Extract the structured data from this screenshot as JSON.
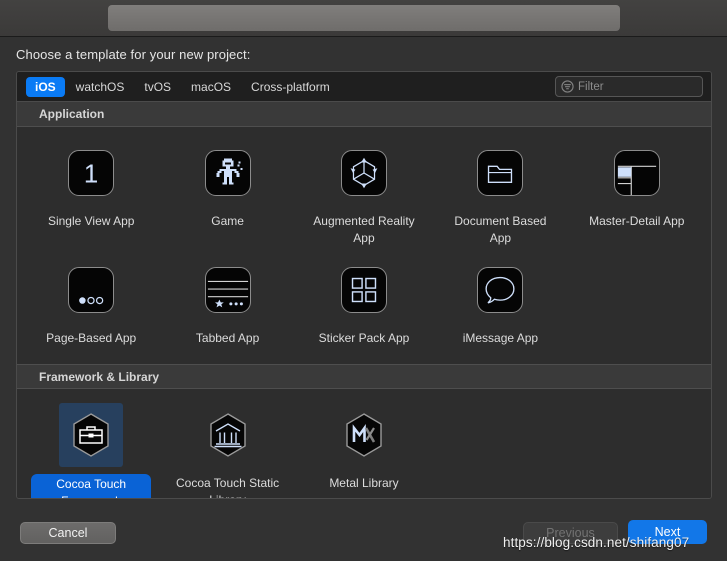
{
  "window": {
    "titlebar_redacted": true
  },
  "prompt": "Choose a template for your new project:",
  "platform_tabs": [
    {
      "label": "iOS",
      "selected": true
    },
    {
      "label": "watchOS",
      "selected": false
    },
    {
      "label": "tvOS",
      "selected": false
    },
    {
      "label": "macOS",
      "selected": false
    },
    {
      "label": "Cross-platform",
      "selected": false
    }
  ],
  "filter": {
    "placeholder": "Filter",
    "value": "",
    "icon": "filter-icon"
  },
  "sections": [
    {
      "title": "Application",
      "templates": [
        {
          "label": "Single View App",
          "icon": "single-view-app-icon",
          "selected": false
        },
        {
          "label": "Game",
          "icon": "game-icon",
          "selected": false
        },
        {
          "label": "Augmented Reality App",
          "icon": "augmented-reality-app-icon",
          "selected": false
        },
        {
          "label": "Document Based App",
          "icon": "document-based-app-icon",
          "selected": false
        },
        {
          "label": "Master-Detail App",
          "icon": "master-detail-app-icon",
          "selected": false
        },
        {
          "label": "Page-Based App",
          "icon": "page-based-app-icon",
          "selected": false
        },
        {
          "label": "Tabbed App",
          "icon": "tabbed-app-icon",
          "selected": false
        },
        {
          "label": "Sticker Pack App",
          "icon": "sticker-pack-app-icon",
          "selected": false
        },
        {
          "label": "iMessage App",
          "icon": "imessage-app-icon",
          "selected": false
        }
      ]
    },
    {
      "title": "Framework & Library",
      "templates": [
        {
          "label": "Cocoa Touch Framework",
          "icon": "cocoa-touch-framework-icon",
          "selected": true
        },
        {
          "label": "Cocoa Touch Static Library",
          "icon": "cocoa-touch-static-library-icon",
          "selected": false
        },
        {
          "label": "Metal Library",
          "icon": "metal-library-icon",
          "selected": false
        }
      ]
    }
  ],
  "buttons": {
    "cancel": "Cancel",
    "previous": "Previous",
    "next": "Next"
  },
  "watermark": "https://blog.csdn.net/shifang07",
  "colors": {
    "accent_blue": "#0a7bf5",
    "selected_label_blue": "#0a63d6",
    "selected_tile_blue": "#27405e",
    "next_button_blue": "#1277e8",
    "panel_bg": "#2d2d2d",
    "window_bg": "#323232",
    "icon_glyph_blue": "#cfe0fb"
  }
}
